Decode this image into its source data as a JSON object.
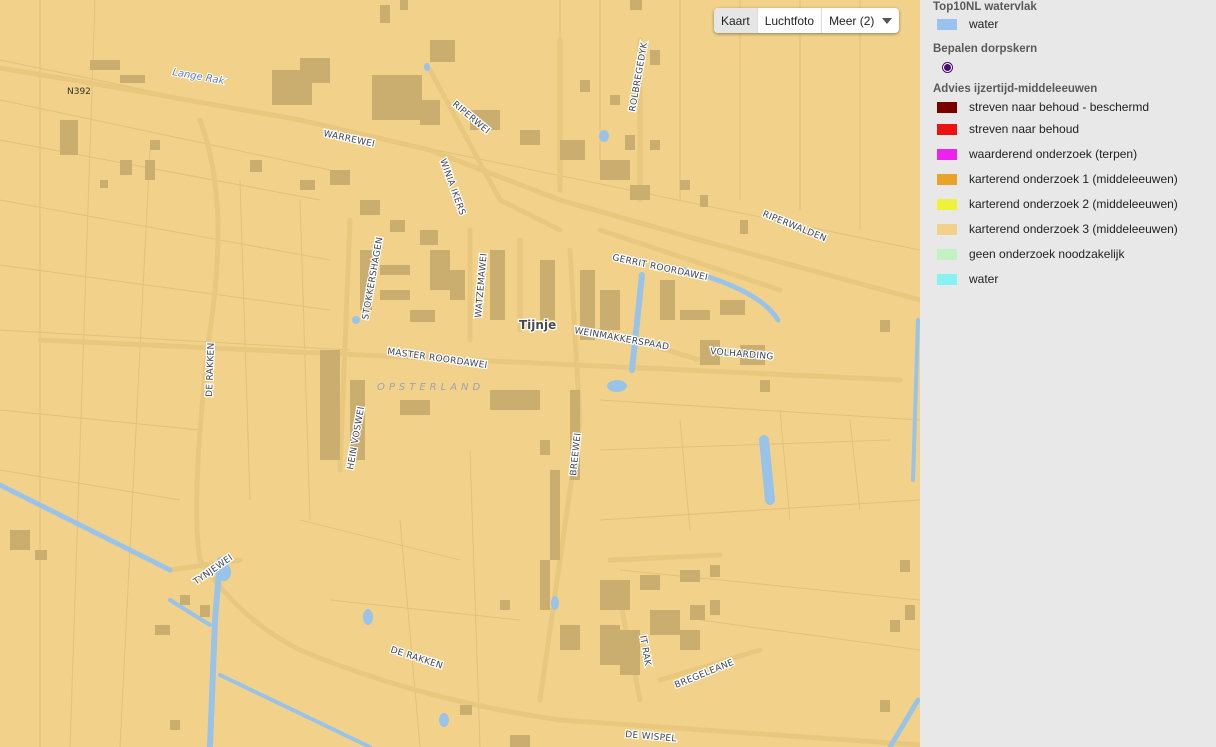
{
  "map": {
    "background": "#f2d28a",
    "building_color": "#c9ae70",
    "water_color": "#99c3e8",
    "road_color": "#e8c87f",
    "labels": {
      "n392": "N392",
      "lange_rak": "Lange Rak",
      "warrewei": "WARREWEI",
      "riperwei": "RIPERWEI",
      "rolbregedyk": "ROLBREGEDYK",
      "winia_ikers": "WINIA IKERS",
      "riperwalden": "RIPERWALDEN",
      "gerrit_roordawei": "GERRIT ROORDAWEI",
      "stokkershagen": "STOKKERSHAGEN",
      "watzemawei": "WATZEMAWEI",
      "tijnje": "Tijnje",
      "weinmakkerspaad": "WEINMAKKERSPAAD",
      "volharding": "VOLHARDING",
      "master_roordawei": "MASTER ROORDAWEI",
      "opsterland": "OPSTERLAND",
      "de_rakken_1": "DE RAKKEN",
      "hein_voswei": "HEIN VOSWEI",
      "breewei": "BREEWEI",
      "tynjewei": "TYNJEWEI",
      "de_rakken_2": "DE RAKKEN",
      "it_rak": "IT RAK",
      "bregeleane": "BREGELEANE",
      "de_wispel": "DE WISPEL"
    }
  },
  "map_type_control": {
    "buttons": [
      "Kaart",
      "Luchtfoto",
      "Meer (2)"
    ],
    "active": "Kaart"
  },
  "legend": {
    "sections": [
      {
        "title": "Top10NL watervlak",
        "items": [
          {
            "label": "water",
            "color": "#99c3ef"
          }
        ]
      },
      {
        "title": "Bepalen dorpskern",
        "items": [
          {
            "label": "",
            "color": "#4b0c6e",
            "symbol": "dot"
          }
        ]
      },
      {
        "title": "Advies ijzertijd-middeleeuwen",
        "items": [
          {
            "label": "streven naar behoud - beschermd",
            "color": "#7a0000"
          },
          {
            "label": "streven naar behoud",
            "color": "#ee1111"
          },
          {
            "label": "waarderend onderzoek (terpen)",
            "color": "#ee22ee"
          },
          {
            "label": "karterend onderzoek 1 (middeleeuwen)",
            "color": "#e8a428"
          },
          {
            "label": "karterend onderzoek 2 (middeleeuwen)",
            "color": "#eef23a"
          },
          {
            "label": "karterend onderzoek 3 (middeleeuwen)",
            "color": "#f2d28a"
          },
          {
            "label": "geen onderzoek noodzakelijk",
            "color": "#c2f2c2"
          },
          {
            "label": "water",
            "color": "#88f2f2"
          }
        ]
      }
    ]
  }
}
